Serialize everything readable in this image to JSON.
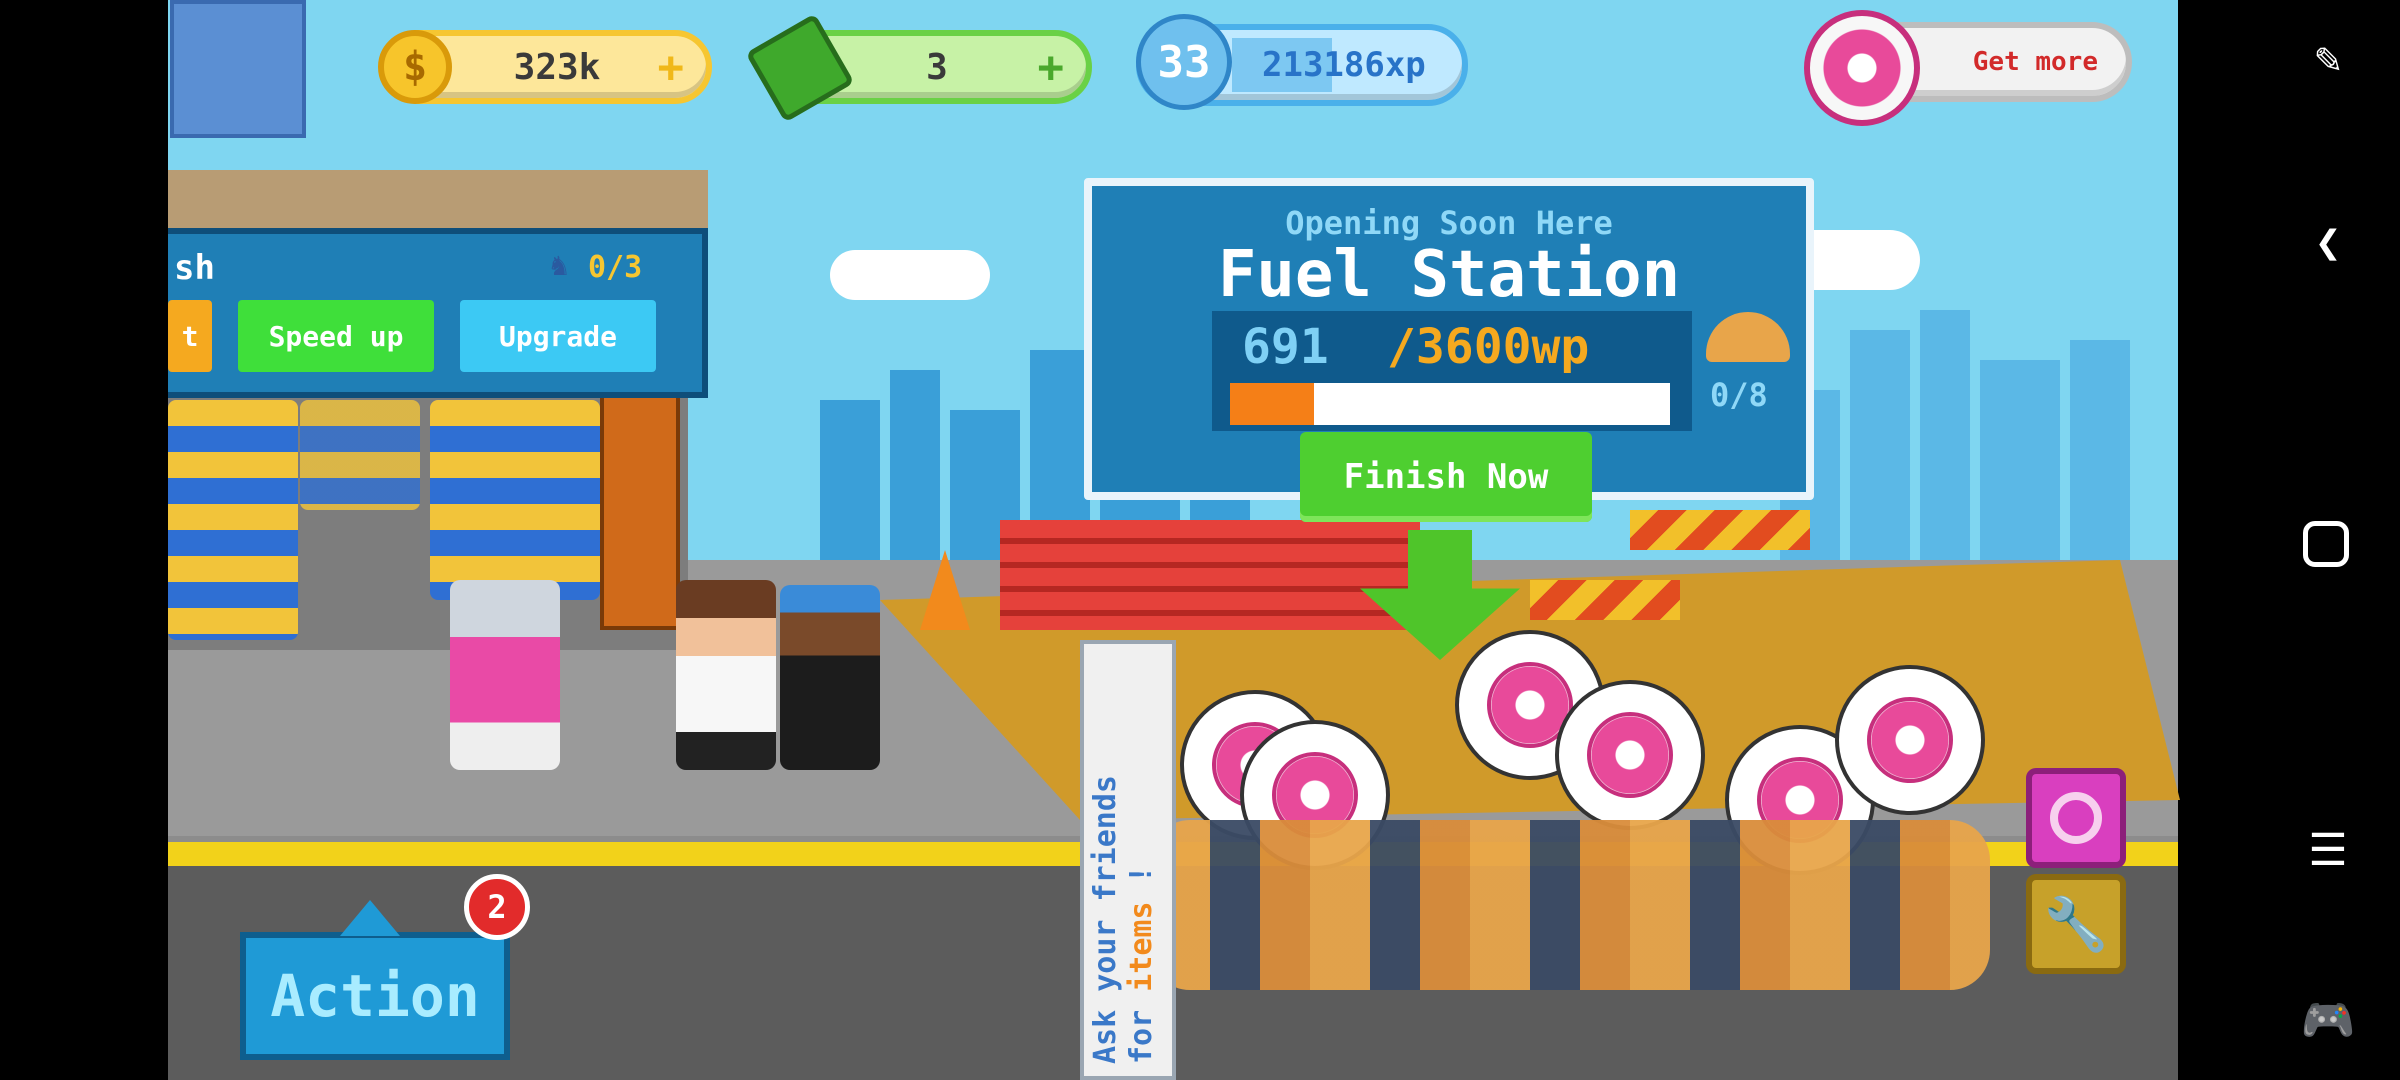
{
  "hud": {
    "coins": "323k",
    "coins_plus": "+",
    "cash": "3",
    "cash_plus": "+",
    "level": "33",
    "xp": "213186xp",
    "get_more": "Get more"
  },
  "car_wash": {
    "title_partial": "sh",
    "workers": "0/3",
    "left_button_partial": "t",
    "speed_up": "Speed up",
    "upgrade": "Upgrade"
  },
  "construction": {
    "subtitle": "Opening Soon Here",
    "title": "Fuel Station",
    "progress_current": "691",
    "progress_total": "/3600wp",
    "progress_fraction": 0.192,
    "helmets": "0/8",
    "finish_now": "Finish Now"
  },
  "ask_friends": {
    "line1": "Ask your friends",
    "line2": "for",
    "line2_highlight": "items",
    "line3": "!"
  },
  "action": {
    "label": "Action",
    "badge": "2"
  },
  "colors": {
    "sky": "#7fd6f1",
    "accent_green": "#5fd23a",
    "accent_blue": "#1f7fb6",
    "progress_orange": "#f57f17"
  }
}
